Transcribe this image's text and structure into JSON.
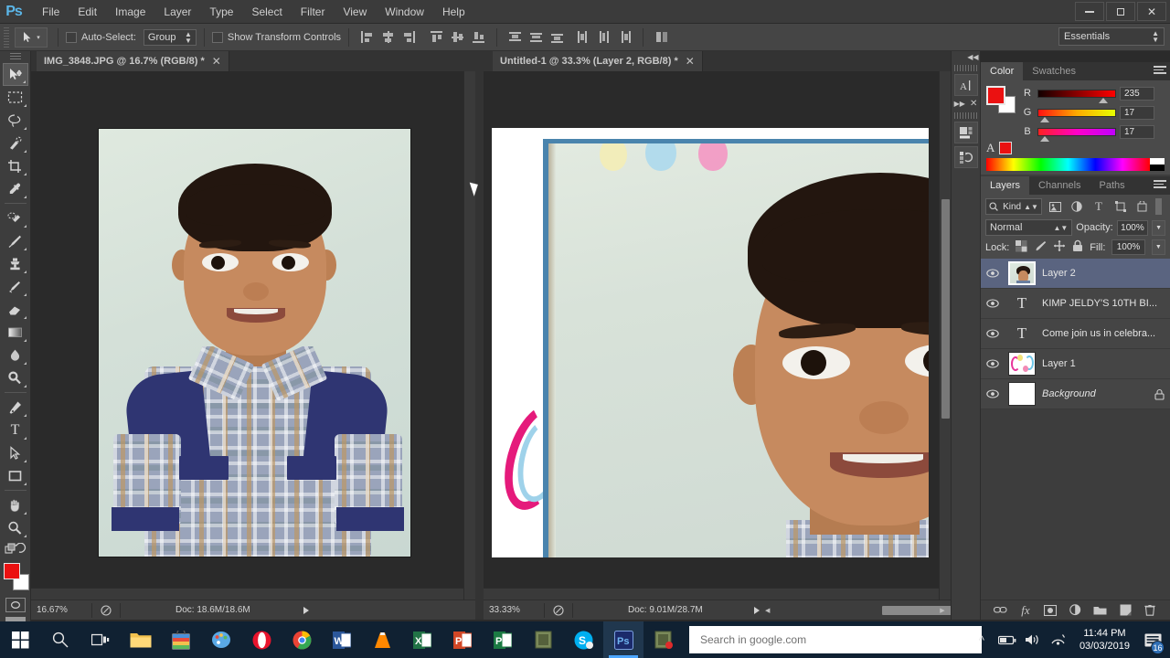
{
  "app": {
    "logo": "Ps",
    "menus": [
      "File",
      "Edit",
      "Image",
      "Layer",
      "Type",
      "Select",
      "Filter",
      "View",
      "Window",
      "Help"
    ],
    "window_controls": {
      "minimize": "minimize-icon",
      "restore": "restore-icon",
      "close": "✕"
    }
  },
  "options_bar": {
    "tool_icon": "move-tool-icon",
    "auto_select_label": "Auto-Select:",
    "auto_select_checked": false,
    "group_value": "Group",
    "show_transform_label": "Show Transform Controls",
    "show_transform_checked": false,
    "align_icons": [
      "align-left-edges-icon",
      "align-horizontal-centers-icon",
      "align-right-edges-icon",
      "align-top-edges-icon",
      "align-vertical-centers-icon",
      "align-bottom-edges-icon",
      "distribute-top-icon",
      "distribute-vertical-center-icon",
      "distribute-bottom-icon",
      "distribute-left-icon",
      "distribute-horizontal-center-icon",
      "distribute-right-icon",
      "auto-align-icon"
    ],
    "workspace": "Essentials"
  },
  "toolbar": {
    "tools": [
      {
        "name": "move-tool",
        "glyph": "move",
        "active": true
      },
      {
        "name": "rectangular-marquee-tool",
        "glyph": "marquee",
        "active": false
      },
      {
        "name": "lasso-tool",
        "glyph": "lasso",
        "active": false
      },
      {
        "name": "quick-selection-tool",
        "glyph": "quickselect",
        "active": false
      },
      {
        "name": "crop-tool",
        "glyph": "crop",
        "active": false
      },
      {
        "name": "eyedropper-tool",
        "glyph": "eyedropper",
        "active": false
      },
      {
        "name": "spot-healing-brush-tool",
        "glyph": "healing",
        "active": false
      },
      {
        "name": "brush-tool",
        "glyph": "brush",
        "active": false
      },
      {
        "name": "clone-stamp-tool",
        "glyph": "stamp",
        "active": false
      },
      {
        "name": "history-brush-tool",
        "glyph": "historybrush",
        "active": false
      },
      {
        "name": "eraser-tool",
        "glyph": "eraser",
        "active": false
      },
      {
        "name": "gradient-tool",
        "glyph": "gradient",
        "active": false
      },
      {
        "name": "blur-tool",
        "glyph": "blur",
        "active": false
      },
      {
        "name": "dodge-tool",
        "glyph": "dodge",
        "active": false
      },
      {
        "name": "pen-tool",
        "glyph": "pen",
        "active": false
      },
      {
        "name": "horizontal-type-tool",
        "glyph": "type",
        "active": false
      },
      {
        "name": "path-selection-tool",
        "glyph": "pathselect",
        "active": false
      },
      {
        "name": "rectangle-tool",
        "glyph": "rectangle",
        "active": false
      },
      {
        "name": "hand-tool",
        "glyph": "hand",
        "active": false
      },
      {
        "name": "zoom-tool",
        "glyph": "zoom",
        "active": false
      }
    ],
    "foreground_color": "#eb1111",
    "background_color": "#ffffff"
  },
  "documents": [
    {
      "tab_title": "IMG_3848.JPG @ 16.7% (RGB/8) *",
      "close_label": "✕",
      "zoom_label": "16.67%",
      "doc_info": "Doc: 18.6M/18.6M"
    },
    {
      "tab_title": "Untitled-1 @ 33.3% (Layer 2, RGB/8) *",
      "close_label": "✕",
      "zoom_label": "33.33%",
      "doc_info": "Doc: 9.01M/28.7M"
    }
  ],
  "color_panel": {
    "tabs": [
      "Color",
      "Swatches"
    ],
    "active_tab": "Color",
    "channels": [
      {
        "label": "R",
        "value": "235"
      },
      {
        "label": "G",
        "value": "17"
      },
      {
        "label": "B",
        "value": "17"
      }
    ],
    "foreground": "#eb1111",
    "background": "#ffffff"
  },
  "layers_panel": {
    "tabs": [
      "Layers",
      "Channels",
      "Paths"
    ],
    "active_tab": "Layers",
    "filter_kind": "Kind",
    "filter_icons": [
      "pixel-filter-icon",
      "adjustment-filter-icon",
      "type-filter-icon",
      "shape-filter-icon",
      "smart-object-filter-icon"
    ],
    "blend_mode": "Normal",
    "opacity_label": "Opacity:",
    "opacity_value": "100%",
    "lock_label": "Lock:",
    "lock_icons": [
      "lock-transparent-pixels-icon",
      "lock-image-pixels-icon",
      "lock-position-icon",
      "lock-all-icon"
    ],
    "fill_label": "Fill:",
    "fill_value": "100%",
    "layers": [
      {
        "name": "Layer 2",
        "type": "image",
        "visible": true,
        "selected": true,
        "locked": false
      },
      {
        "name": "KIMP JELDY'S  10TH BI...",
        "type": "text",
        "visible": true,
        "selected": false,
        "locked": false
      },
      {
        "name": "Come join us in celebra...",
        "type": "text",
        "visible": true,
        "selected": false,
        "locked": false
      },
      {
        "name": "Layer 1",
        "type": "image",
        "visible": true,
        "selected": false,
        "locked": false
      },
      {
        "name": "Background",
        "type": "background",
        "visible": true,
        "selected": false,
        "locked": true
      }
    ],
    "footer_buttons": [
      "link-layers-icon",
      "layer-style-fx-icon",
      "add-layer-mask-icon",
      "new-adjustment-layer-icon",
      "new-group-icon",
      "new-layer-icon",
      "delete-layer-icon"
    ]
  },
  "mini_dock": {
    "icons": [
      "character-panel-icon",
      "adjustments-panel-icon",
      "history-panel-icon"
    ],
    "collapse_label": "◀◀",
    "close_label": "✕"
  },
  "taskbar": {
    "apps": [
      {
        "name": "start-button",
        "label": "⊞",
        "color": "transparent"
      },
      {
        "name": "search-button",
        "label": "search-icon",
        "color": "transparent"
      },
      {
        "name": "task-view-button",
        "label": "taskview-icon",
        "color": "transparent"
      },
      {
        "name": "file-explorer",
        "label": "folder-icon",
        "color": "#f0c14b"
      },
      {
        "name": "microsoft-store",
        "label": "store-icon",
        "color": "#e8e8e8"
      },
      {
        "name": "paint-3d",
        "label": "paint-icon",
        "color": "#4a90d9"
      },
      {
        "name": "opera-browser",
        "label": "O",
        "color": "#e8142d"
      },
      {
        "name": "google-chrome",
        "label": "chrome-icon",
        "color": "#ffffff"
      },
      {
        "name": "microsoft-word",
        "label": "W",
        "color": "#2b579a"
      },
      {
        "name": "vlc-media-player",
        "label": "vlc-icon",
        "color": "#ff8800"
      },
      {
        "name": "microsoft-excel",
        "label": "X",
        "color": "#217346"
      },
      {
        "name": "microsoft-powerpoint",
        "label": "P",
        "color": "#d24726"
      },
      {
        "name": "microsoft-publisher",
        "label": "P",
        "color": "#1b7a43"
      },
      {
        "name": "notes-app",
        "label": "note-icon",
        "color": "#6f7a52"
      },
      {
        "name": "skype",
        "label": "S",
        "color": "#00aff0"
      },
      {
        "name": "adobe-photoshop",
        "label": "Ps",
        "color": "#2b3a8f"
      },
      {
        "name": "photo-app",
        "label": "photo-icon",
        "color": "#7a8e4a"
      }
    ],
    "search_placeholder": "Search in google.com",
    "tray": {
      "show_hidden": "^",
      "battery": "battery-icon",
      "volume": "volume-icon",
      "network": "network-icon",
      "time": "11:44 PM",
      "date": "03/03/2019",
      "notification_count": "16"
    }
  }
}
